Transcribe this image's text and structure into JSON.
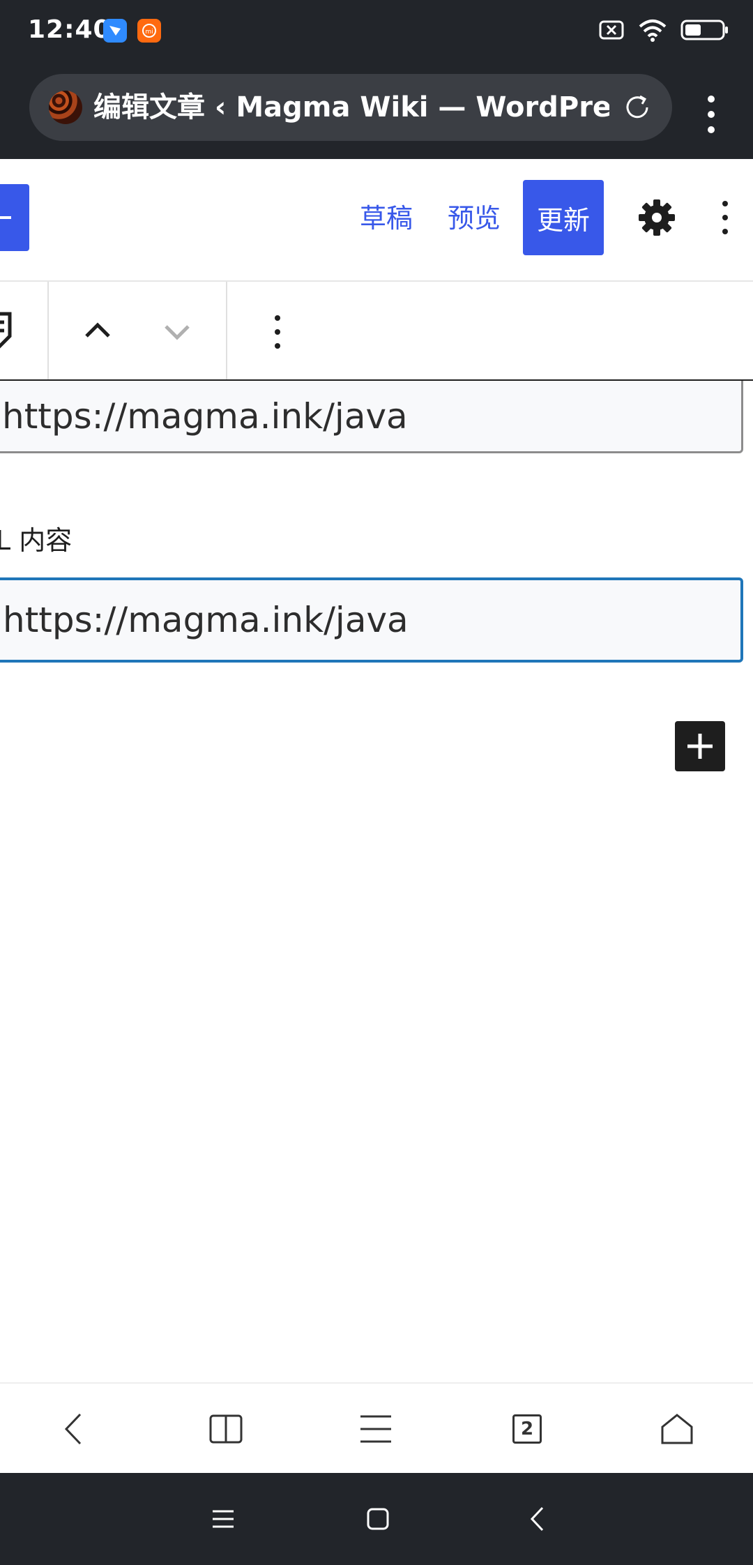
{
  "status_bar": {
    "time": "12:40",
    "app_icons": [
      "feishu-icon",
      "mi-icon"
    ],
    "indicators": [
      "no-sim-icon",
      "wifi-icon",
      "battery-icon"
    ]
  },
  "browser": {
    "title": "编辑文章 ‹ Magma Wiki — WordPress",
    "tab_count": "2"
  },
  "editor_header": {
    "save_draft_label": "草稿",
    "preview_label": "预览",
    "update_label": "更新"
  },
  "block": {
    "field_1_value": "https://magma.ink/java",
    "field_2_label": "L 内容",
    "field_2_value": "https://magma.ink/java"
  },
  "colors": {
    "accent": "#3858e9",
    "focus_border": "#1f76b9",
    "dark_bar": "#22252a"
  }
}
